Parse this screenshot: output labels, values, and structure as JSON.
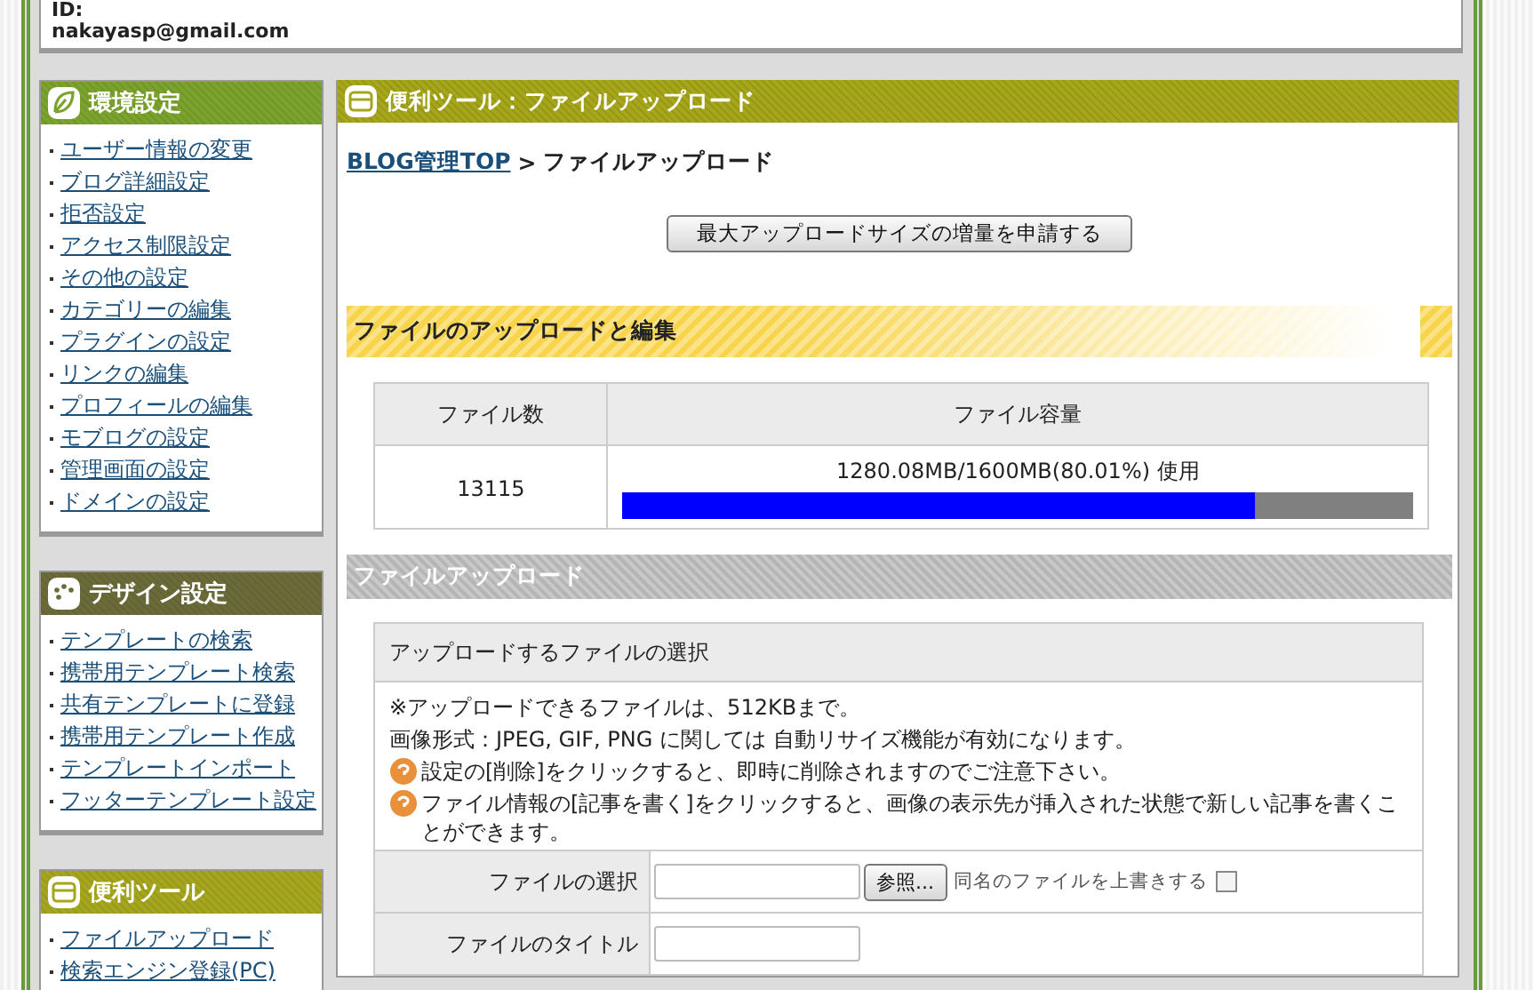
{
  "account": {
    "label": "ID:",
    "email": "nakayasp@gmail.com"
  },
  "sidebar": [
    {
      "kind": "leaf",
      "title": "環境設定",
      "items": [
        "ユーザー情報の変更",
        "ブログ詳細設定",
        "拒否設定",
        "アクセス制限設定",
        "その他の設定",
        "カテゴリーの編集",
        "プラグインの設定",
        "リンクの編集",
        "プロフィールの編集",
        "モブログの設定",
        "管理画面の設定",
        "ドメインの設定"
      ]
    },
    {
      "kind": "palette",
      "title": "デザイン設定",
      "items": [
        "テンプレートの検索",
        "携帯用テンプレート検索",
        "共有テンプレートに登録",
        "携帯用テンプレート作成",
        "テンプレートインポート",
        "フッターテンプレート設定"
      ]
    },
    {
      "kind": "tool",
      "title": "便利ツール",
      "items": [
        "ファイルアップロード",
        "検索エンジン登録(PC)"
      ]
    }
  ],
  "main": {
    "title": "便利ツール：ファイルアップロード",
    "breadcrumb": {
      "link": "BLOG管理TOP",
      "separator": ">",
      "current": "ファイルアップロード"
    },
    "request_button": "最大アップロードサイズの増量を申請する",
    "edit_section": {
      "title": "ファイルのアップロードと編集",
      "columns": [
        "ファイル数",
        "ファイル容量"
      ],
      "file_count": "13115",
      "usage": "1280.08MB/1600MB(80.01%) 使用",
      "level": 0.8001
    },
    "upload_section": {
      "title": "ファイルアップロード",
      "box_title": "アップロードするファイルの選択",
      "notes": [
        {
          "kind": "plain",
          "text": "※アップロードできるファイルは、512KBまで。"
        },
        {
          "kind": "plain",
          "text": "画像形式：JPEG, GIF, PNG に関しては 自動リサイズ機能が有効になります。"
        },
        {
          "kind": "tip",
          "text": "設定の[削除]をクリックすると、即時に削除されますのでご注意下さい。"
        },
        {
          "kind": "tip",
          "text": "ファイル情報の[記事を書く]をクリックすると、画像の表示先が挿入された状態で新しい記事を書くことができます。"
        }
      ],
      "form": [
        {
          "kind": "file",
          "label": "ファイルの選択",
          "browse": "参照...",
          "overwrite": "同名のファイルを上書きする",
          "checked": false
        },
        {
          "kind": "text",
          "label": "ファイルのタイトル"
        }
      ]
    }
  }
}
